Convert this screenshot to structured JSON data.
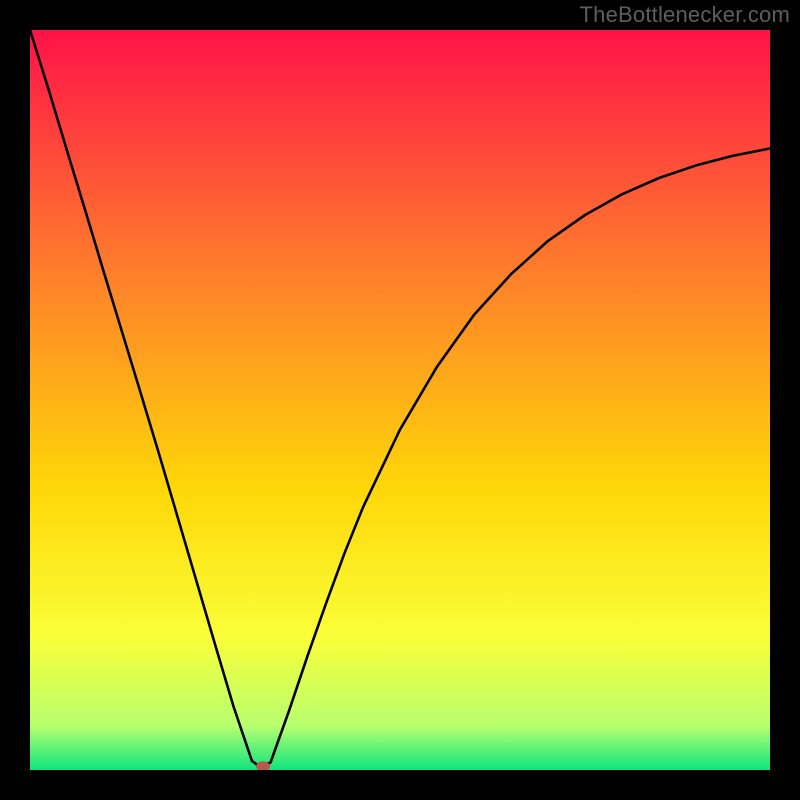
{
  "watermark": "TheBottlenecker.com",
  "chart_data": {
    "type": "line",
    "title": "",
    "xlabel": "",
    "ylabel": "",
    "xlim": [
      0,
      100
    ],
    "ylim": [
      0,
      100
    ],
    "grid": false,
    "colors": {
      "gradient_top": "#ff1249",
      "gradient_mid_upper": "#ff7c2c",
      "gradient_mid": "#ffd708",
      "gradient_mid_lower": "#faff39",
      "gradient_low": "#b8ff6e",
      "gradient_bottom": "#10e57f",
      "curve": "#000000",
      "marker": "#b55a4d"
    },
    "series": [
      {
        "name": "bottleneck-curve",
        "x": [
          0,
          2.5,
          5,
          7.5,
          10,
          12.5,
          15,
          17.5,
          20,
          22.5,
          25,
          27.5,
          30,
          31,
          32.5,
          35,
          37.5,
          40,
          42.5,
          45,
          50,
          55,
          60,
          65,
          70,
          75,
          80,
          85,
          90,
          95,
          100
        ],
        "y": [
          100,
          92,
          83.7,
          75.5,
          67.2,
          59,
          50.8,
          42.5,
          34,
          25.5,
          17,
          8.6,
          1.2,
          0.5,
          1,
          8,
          15.4,
          22.5,
          29.3,
          35.5,
          46,
          54.5,
          61.5,
          67,
          71.5,
          75,
          77.8,
          80,
          81.7,
          83,
          84
        ]
      }
    ],
    "marker": {
      "x": 31.5,
      "y": 0.5,
      "rx": 7,
      "ry": 5
    }
  }
}
